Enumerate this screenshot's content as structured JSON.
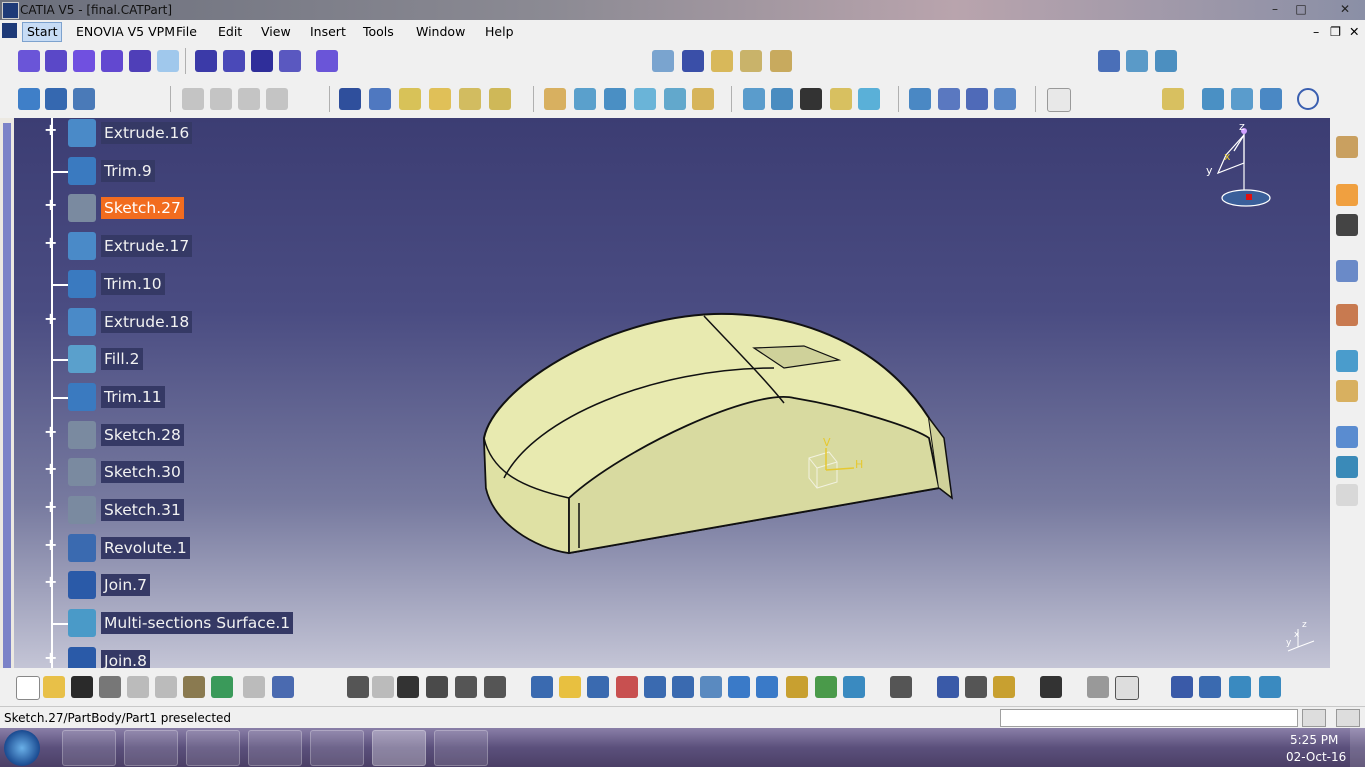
{
  "window": {
    "title": "CATIA V5 - [final.CATPart]",
    "controls": [
      "–",
      "□",
      "✕"
    ],
    "mdi_controls": [
      "–",
      "❐",
      "✕"
    ]
  },
  "menu": {
    "items": [
      "Start",
      "ENOVIA V5 VPM",
      "File",
      "Edit",
      "View",
      "Insert",
      "Tools",
      "Window",
      "Help"
    ]
  },
  "tree": {
    "nodes": [
      {
        "label": "Extrude.16",
        "icon": "extrude-icon",
        "expandable": true
      },
      {
        "label": "Trim.9",
        "icon": "trim-icon",
        "expandable": false
      },
      {
        "label": "Sketch.27",
        "icon": "sketch-icon",
        "expandable": true,
        "selected": true
      },
      {
        "label": "Extrude.17",
        "icon": "extrude-icon",
        "expandable": true
      },
      {
        "label": "Trim.10",
        "icon": "trim-icon",
        "expandable": false
      },
      {
        "label": "Extrude.18",
        "icon": "extrude-icon",
        "expandable": true
      },
      {
        "label": "Fill.2",
        "icon": "fill-icon",
        "expandable": false
      },
      {
        "label": "Trim.11",
        "icon": "trim-icon",
        "expandable": false
      },
      {
        "label": "Sketch.28",
        "icon": "sketch-icon",
        "expandable": true
      },
      {
        "label": "Sketch.30",
        "icon": "sketch-icon",
        "expandable": true
      },
      {
        "label": "Sketch.31",
        "icon": "sketch-icon",
        "expandable": true
      },
      {
        "label": "Revolute.1",
        "icon": "revolute-icon",
        "expandable": true
      },
      {
        "label": "Join.7",
        "icon": "join-icon",
        "expandable": true
      },
      {
        "label": "Multi-sections Surface.1",
        "icon": "multi-section-icon",
        "expandable": false
      },
      {
        "label": "Join.8",
        "icon": "join-icon",
        "expandable": true
      }
    ]
  },
  "compass": {
    "x": "x",
    "y": "y",
    "z": "z"
  },
  "axis_mini": {
    "x": "x",
    "y": "y",
    "z": "z"
  },
  "part_axis": {
    "v": "V",
    "h": "H"
  },
  "status": {
    "text": "Sketch.27/PartBody/Part1 preselected",
    "command_input": ""
  },
  "taskbar": {
    "time": "5:25 PM",
    "date": "02-Oct-16"
  },
  "colors": {
    "viewport_top": "#3c3d73",
    "viewport_bottom": "#c4c5d6",
    "tree_label_bg": "#353965",
    "selected_bg": "#f26c1f",
    "part_surface": "#e8eab0"
  }
}
